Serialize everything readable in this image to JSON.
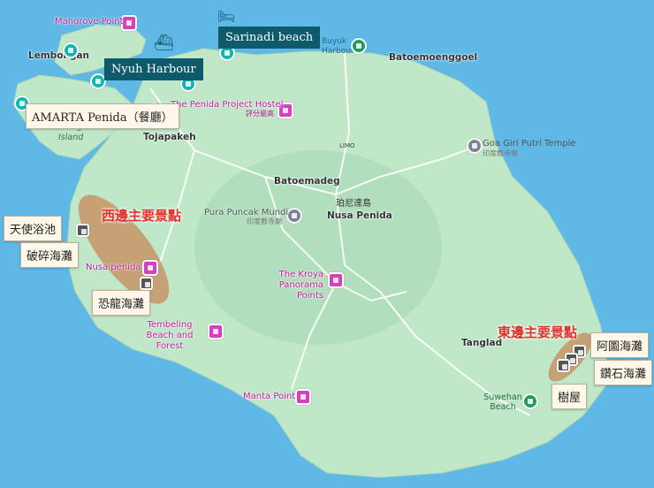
{
  "places": {
    "lembongan": "Lembongan",
    "ceningan": "Ceningan",
    "island": "Island",
    "tojapakeh": "Tojapakeh",
    "batoemadeg": "Batoemadeg",
    "nusa_penida_cn": "珀尼達島",
    "nusa_penida": "Nusa Penida",
    "limo": "LIMO",
    "batoemoenggoel": "Batoemoenggoel",
    "buyuk_harbour": "Buyuk Harbour",
    "tanglad": "Tanglad"
  },
  "pois": {
    "mangrove_point": "Mangrove Point",
    "penida_hostel": "The Penida Project Hostel",
    "penida_hostel_sub": "評分最高",
    "pura_puncak": "Pura Puncak Mundi",
    "pura_puncak_sub": "印度教寺廟",
    "goa_giri": "Goa Giri Putri Temple",
    "goa_giri_sub": "印度教寺廟",
    "kroya": "The Kroya Panorama Points",
    "nusa_penida_poi": "Nusa penida",
    "tembeling": "Tembeling Beach and Forest",
    "manta_point": "Manta Point",
    "suwehan": "Suwehan Beach"
  },
  "callouts": {
    "sarinadi": "Sarinadi beach",
    "nyuh": "Nyuh Harbour",
    "amarta": "AMARTA Penida（餐廳）",
    "angel": "天使浴池",
    "broken": "破碎海灘",
    "kelingking": "恐龍海灘",
    "atuh": "阿圖海灘",
    "diamond": "鑽石海灘",
    "treehouse": "樹屋"
  },
  "regions": {
    "west": "西邊主要景點",
    "east": "東邊主要景點"
  },
  "colors": {
    "sea": "#5fb8e6",
    "land": "#bfe7c8",
    "highlight": "#c88a5a",
    "region_text": "#e0322c"
  }
}
